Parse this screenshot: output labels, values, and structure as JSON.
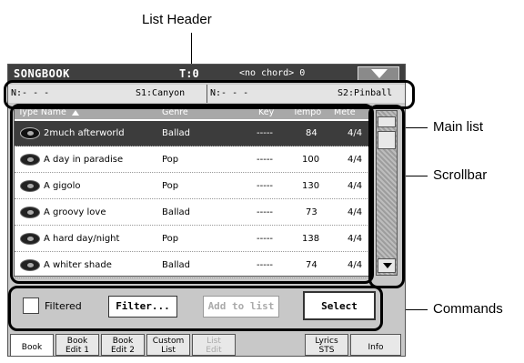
{
  "callouts": {
    "list_header": "List Header",
    "main_list": "Main list",
    "scrollbar": "Scrollbar",
    "commands": "Commands"
  },
  "titlebar": {
    "title": "SONGBOOK",
    "track": "T:0",
    "chord": "<no chord> 0"
  },
  "header_strip": {
    "left_n": "N:- - -",
    "left_s": "S1:Canyon",
    "right_n": "N:- - -",
    "right_s": "S2:Pinball"
  },
  "columns": {
    "type_name": "Type Name",
    "genre": "Genre",
    "key": "Key",
    "tempo": "Tempo",
    "meter": "Mete"
  },
  "rows": [
    {
      "name": "2much afterworld",
      "genre": "Ballad",
      "key": "-----",
      "tempo": "84",
      "meter": "4/4"
    },
    {
      "name": "A day in paradise",
      "genre": "Pop",
      "key": "-----",
      "tempo": "100",
      "meter": "4/4"
    },
    {
      "name": "A gigolo",
      "genre": "Pop",
      "key": "-----",
      "tempo": "130",
      "meter": "4/4"
    },
    {
      "name": "A groovy love",
      "genre": "Ballad",
      "key": "-----",
      "tempo": "73",
      "meter": "4/4"
    },
    {
      "name": "A hard day/night",
      "genre": "Pop",
      "key": "-----",
      "tempo": "138",
      "meter": "4/4"
    },
    {
      "name": "A whiter shade",
      "genre": "Ballad",
      "key": "-----",
      "tempo": "74",
      "meter": "4/4"
    }
  ],
  "commands": {
    "filtered": "Filtered",
    "filter": "Filter...",
    "add_to_list": "Add to list",
    "select": "Select"
  },
  "tabs": {
    "book": "Book",
    "book_edit_1": [
      "Book",
      "Edit 1"
    ],
    "book_edit_2": [
      "Book",
      "Edit 2"
    ],
    "custom_list": [
      "Custom",
      "List"
    ],
    "list_edit": [
      "List",
      "Edit"
    ],
    "lyrics_sts": [
      "Lyrics",
      "STS"
    ],
    "info": "Info"
  }
}
